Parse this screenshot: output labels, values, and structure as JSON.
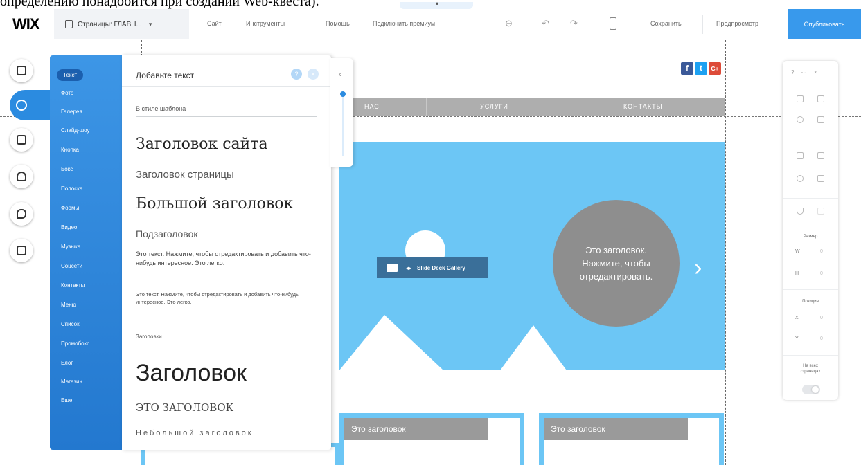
{
  "document_fragment": "определению понадобится при создании Web-квеста).",
  "topbar": {
    "logo": "WIX",
    "pages": "Страницы: ГЛАВН...",
    "menu": [
      "Сайт",
      "Инструменты",
      "Помощь",
      "Подключить премиум"
    ],
    "save": "Сохранить",
    "preview": "Предпросмотр",
    "publish": "Опубликовать"
  },
  "categories": {
    "items": [
      "Текст",
      "Фото",
      "Галерея",
      "Слайд-шоу",
      "Кнопка",
      "Бокс",
      "Полоска",
      "Формы",
      "Видео",
      "Музыка",
      "Соцсети",
      "Контакты",
      "Меню",
      "Список",
      "Промобокс",
      "Блог",
      "Магазин",
      "Еще"
    ]
  },
  "text_panel": {
    "title": "Добавьте текст",
    "help": "?",
    "close": "×",
    "section_template": "В стиле шаблона",
    "site_title": "Заголовок сайта",
    "page_title": "Заголовок страницы",
    "big_title": "Большой заголовок",
    "subtitle": "Подзаголовок",
    "paragraph1": "Это текст. Нажмите, чтобы отредактировать и добавить что-нибудь интересное. Это легко.",
    "paragraph2": "Это текст. Нажмите, чтобы отредактировать и добавить что-нибудь интересное. Это легко.",
    "section_titles": "Заголовки",
    "title_sans": "Заголовок",
    "title_caps": "ЭТО ЗАГОЛОВОК",
    "title_spaced": "Небольшой заголовок"
  },
  "site": {
    "nav": [
      "НАС",
      "УСЛУГИ",
      "КОНТАКТЫ"
    ],
    "social": [
      "f",
      "t",
      "G+"
    ],
    "hero_text": "Это заголовок. Нажмите, чтобы отредактировать.",
    "gallery_label": "Slide Deck Gallery",
    "card_titles": [
      "Это заголовок",
      "Это заголовок"
    ]
  },
  "inspector": {
    "size_label": "Размер",
    "w": "W",
    "h": "H",
    "position_label": "Позиция",
    "x": "X",
    "y": "Y",
    "all_pages": "На всех страницах"
  }
}
